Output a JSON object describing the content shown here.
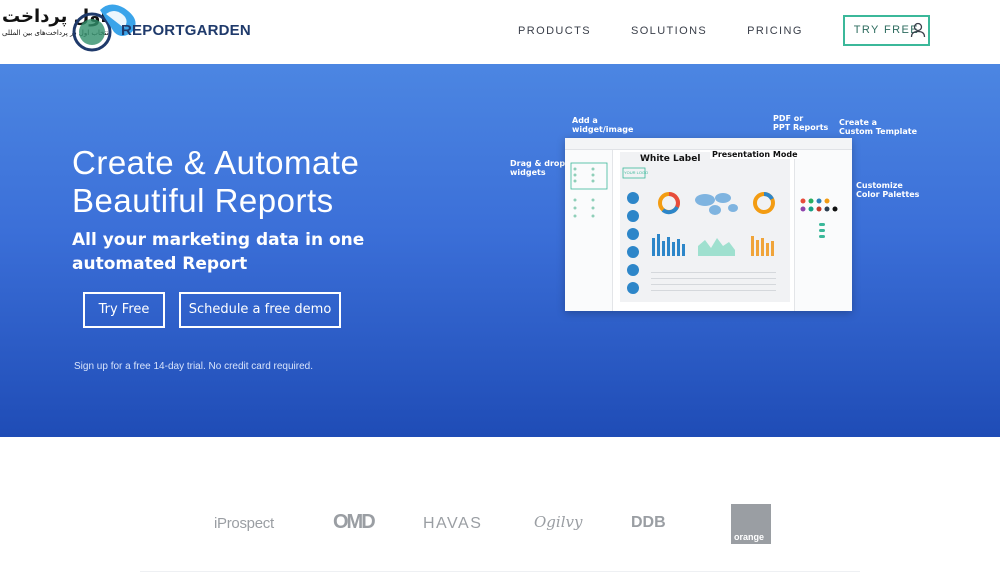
{
  "header": {
    "logo_fa_main": "اول پرداخت",
    "logo_fa_sub": "انتخاب اول در پرداخت‌های بین المللی",
    "brand": "REPORTGARDEN",
    "nav": [
      {
        "label": "PRODUCTS"
      },
      {
        "label": "SOLUTIONS"
      },
      {
        "label": "PRICING"
      }
    ],
    "try_free": "TRY FREE",
    "user_icon": "user-icon"
  },
  "hero": {
    "title_line1": "Create & Automate",
    "title_line2": "Beautiful Reports",
    "subtitle": "All your marketing data in one automated Report",
    "btn_try": "Try Free",
    "btn_demo": "Schedule a free demo",
    "note": "Sign up for a free 14-day trial. No credit card required."
  },
  "mock": {
    "callouts": {
      "add_widget": [
        "Add a",
        "widget/image"
      ],
      "pdf": [
        "PDF or",
        "PPT Reports"
      ],
      "template": [
        "Create a",
        "Custom Template"
      ],
      "drag": [
        "Drag & drop",
        "widgets"
      ],
      "white_label": "White Label",
      "presentation": "Presentation Mode",
      "palettes": [
        "Customize",
        "Color Palettes"
      ]
    },
    "inner_logo": "YOUR LOGO"
  },
  "clients": {
    "iprospect": "iProspect",
    "omd": "OMD",
    "havas": "HAVAS",
    "ogilvy": "Ogilvy",
    "ddb": "DDB",
    "orange": "orange"
  },
  "colors": {
    "accent": "#3bb89a",
    "hero_top": "#4c86e2",
    "hero_bottom": "#1f4cb6",
    "brand_text": "#1f3a6b"
  }
}
